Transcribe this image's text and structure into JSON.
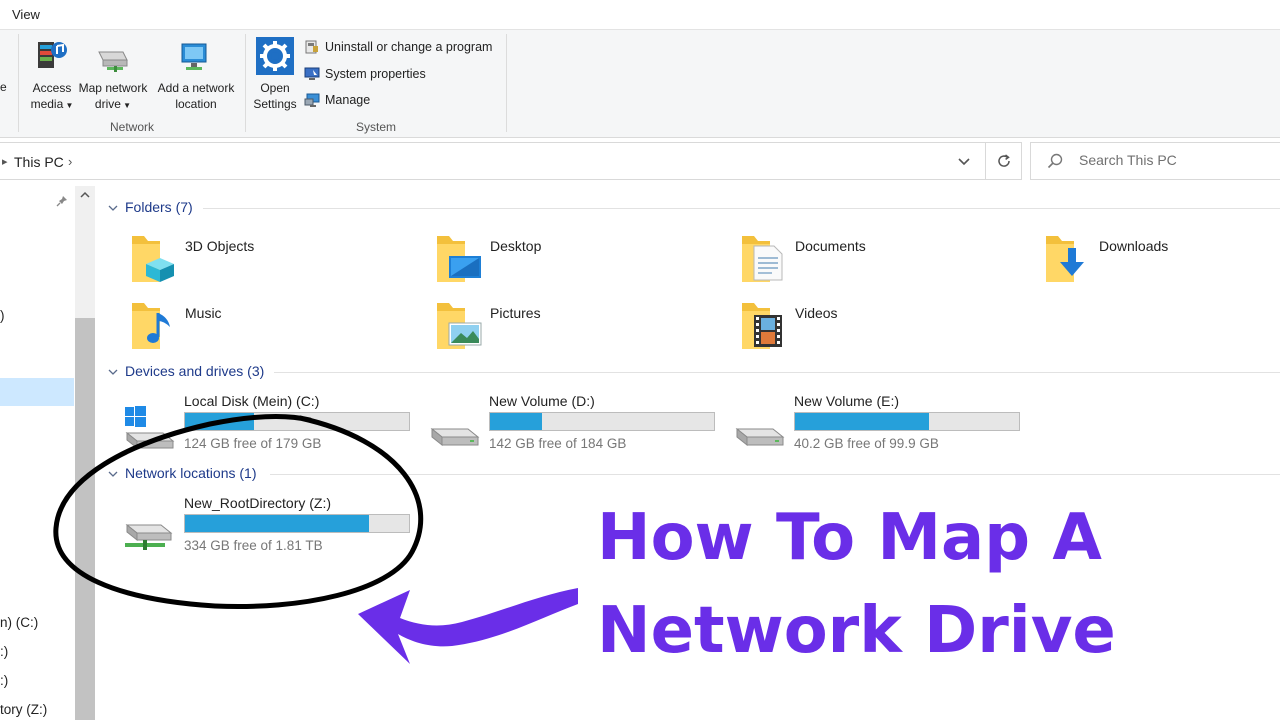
{
  "ribbon": {
    "tab_view": "View",
    "edge_fragment": "e",
    "network_group": {
      "label": "Network",
      "access_media": [
        "Access",
        "media"
      ],
      "map_network_drive": [
        "Map network",
        "drive"
      ],
      "add_network_location": [
        "Add a network",
        "location"
      ]
    },
    "open_settings": [
      "Open",
      "Settings"
    ],
    "system_group": {
      "label": "System",
      "uninstall": "Uninstall or change a program",
      "system_properties": "System properties",
      "manage": "Manage"
    }
  },
  "address_bar": {
    "crumb": "This PC",
    "search_placeholder": "Search This PC"
  },
  "nav_pane": {
    "items": [
      ")",
      "n) (C:)",
      ":)",
      ":)",
      "tory (Z:)"
    ]
  },
  "sections": {
    "folders": {
      "title": "Folders (7)",
      "items": [
        "3D Objects",
        "Desktop",
        "Documents",
        "Downloads",
        "Music",
        "Pictures",
        "Videos"
      ]
    },
    "devices": {
      "title": "Devices and drives (3)",
      "drives": [
        {
          "name": "Local Disk (Mein) (C:)",
          "free": "124 GB free of 179 GB",
          "used_fraction": 0.31
        },
        {
          "name": "New Volume (D:)",
          "free": "142 GB free of 184 GB",
          "used_fraction": 0.23
        },
        {
          "name": "New Volume (E:)",
          "free": "40.2 GB free of 99.9 GB",
          "used_fraction": 0.6
        }
      ]
    },
    "network": {
      "title": "Network locations (1)",
      "drives": [
        {
          "name": "New_RootDirectory (Z:)",
          "free": "334 GB free of 1.81 TB",
          "used_fraction": 0.82
        }
      ]
    }
  },
  "overlay": {
    "headline_line1": "How To Map A",
    "headline_line2": "Network Drive",
    "accent_color": "#6a2ee8",
    "bar_color": "#26a0da"
  }
}
